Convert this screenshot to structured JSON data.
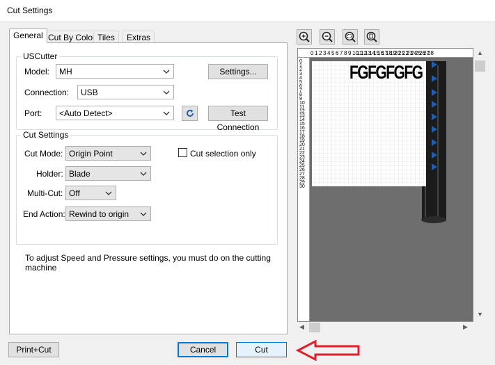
{
  "window": {
    "title": "Cut Settings"
  },
  "tabs": [
    "General",
    "Cut By Color",
    "Tiles",
    "Extras"
  ],
  "uscutter": {
    "group_title": "USCutter",
    "model_label": "Model:",
    "model_value": "MH",
    "connection_label": "Connection:",
    "connection_value": "USB",
    "port_label": "Port:",
    "port_value": "<Auto Detect>",
    "settings_button": "Settings...",
    "test_connection_button": "Test Connection"
  },
  "cut_settings": {
    "group_title": "Cut Settings",
    "cut_mode_label": "Cut Mode:",
    "cut_mode_value": "Origin Point",
    "holder_label": "Holder:",
    "holder_value": "Blade",
    "multi_cut_label": "Multi-Cut:",
    "multi_cut_value": "Off",
    "end_action_label": "End Action:",
    "end_action_value": "Rewind to origin",
    "cut_selection_only_label": "Cut selection only",
    "cut_selection_only_checked": false
  },
  "info_text_line1": "To adjust Speed and Pressure settings, you must do on the cutting",
  "info_text_line2": "machine",
  "preview": {
    "design_text": "FGFGFGFG",
    "ruler_top": [
      "0",
      "1",
      "2",
      "3",
      "4",
      "5",
      "6",
      "7",
      "8",
      "9",
      "10",
      "11",
      "12",
      "13",
      "14",
      "15",
      "16",
      "17",
      "18",
      "19",
      "20",
      "21",
      "22",
      "23",
      "24",
      "25",
      "26",
      "27",
      "28"
    ],
    "ruler_left": [
      "0",
      "1",
      "2",
      "3",
      "4",
      "5",
      "6",
      "7",
      "8",
      "9",
      "10",
      "11",
      "12",
      "13",
      "14",
      "15",
      "16",
      "17",
      "18",
      "19",
      "20",
      "21",
      "22",
      "23",
      "24",
      "25",
      "26",
      "27",
      "28",
      "29",
      "30"
    ]
  },
  "toolbar_icons": [
    "zoom-in-icon",
    "zoom-out-icon",
    "zoom-fit-icon",
    "zoom-page-icon"
  ],
  "buttons": {
    "print_cut": "Print+Cut",
    "cancel": "Cancel",
    "cut": "Cut"
  },
  "colors": {
    "arrow_annotation": "#e0202a",
    "accent": "#0078d7",
    "preview_bg": "#6e6e6e",
    "roller_marker": "#1f5fae"
  }
}
